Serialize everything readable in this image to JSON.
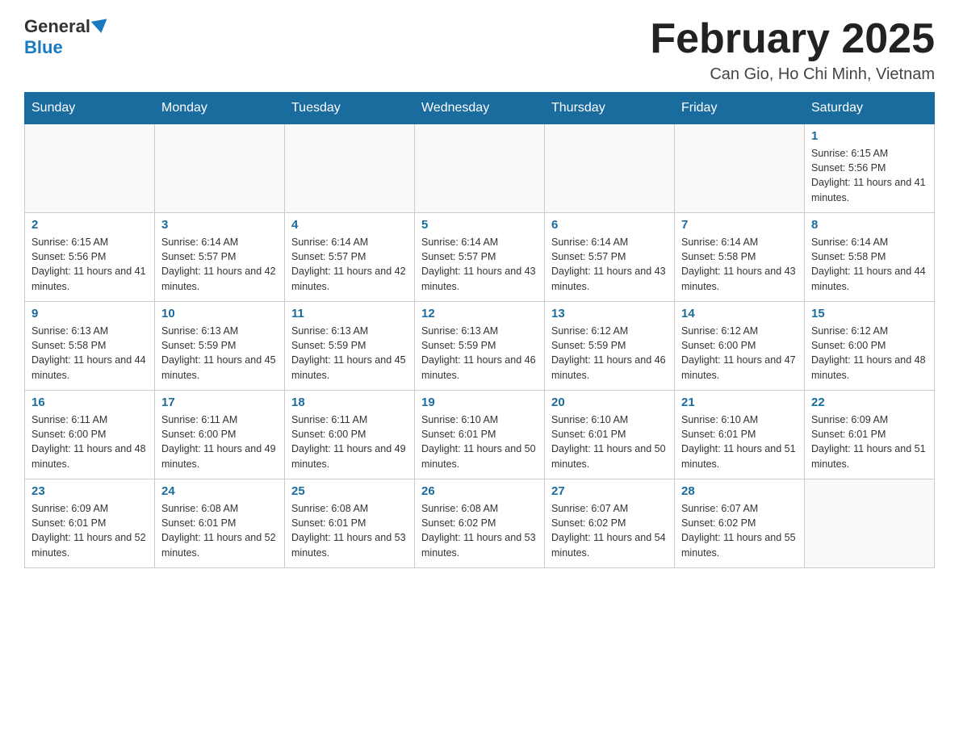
{
  "header": {
    "logo_general": "General",
    "logo_blue": "Blue",
    "title": "February 2025",
    "subtitle": "Can Gio, Ho Chi Minh, Vietnam"
  },
  "days_of_week": [
    "Sunday",
    "Monday",
    "Tuesday",
    "Wednesday",
    "Thursday",
    "Friday",
    "Saturday"
  ],
  "weeks": [
    [
      {
        "num": "",
        "info": ""
      },
      {
        "num": "",
        "info": ""
      },
      {
        "num": "",
        "info": ""
      },
      {
        "num": "",
        "info": ""
      },
      {
        "num": "",
        "info": ""
      },
      {
        "num": "",
        "info": ""
      },
      {
        "num": "1",
        "info": "Sunrise: 6:15 AM\nSunset: 5:56 PM\nDaylight: 11 hours and 41 minutes."
      }
    ],
    [
      {
        "num": "2",
        "info": "Sunrise: 6:15 AM\nSunset: 5:56 PM\nDaylight: 11 hours and 41 minutes."
      },
      {
        "num": "3",
        "info": "Sunrise: 6:14 AM\nSunset: 5:57 PM\nDaylight: 11 hours and 42 minutes."
      },
      {
        "num": "4",
        "info": "Sunrise: 6:14 AM\nSunset: 5:57 PM\nDaylight: 11 hours and 42 minutes."
      },
      {
        "num": "5",
        "info": "Sunrise: 6:14 AM\nSunset: 5:57 PM\nDaylight: 11 hours and 43 minutes."
      },
      {
        "num": "6",
        "info": "Sunrise: 6:14 AM\nSunset: 5:57 PM\nDaylight: 11 hours and 43 minutes."
      },
      {
        "num": "7",
        "info": "Sunrise: 6:14 AM\nSunset: 5:58 PM\nDaylight: 11 hours and 43 minutes."
      },
      {
        "num": "8",
        "info": "Sunrise: 6:14 AM\nSunset: 5:58 PM\nDaylight: 11 hours and 44 minutes."
      }
    ],
    [
      {
        "num": "9",
        "info": "Sunrise: 6:13 AM\nSunset: 5:58 PM\nDaylight: 11 hours and 44 minutes."
      },
      {
        "num": "10",
        "info": "Sunrise: 6:13 AM\nSunset: 5:59 PM\nDaylight: 11 hours and 45 minutes."
      },
      {
        "num": "11",
        "info": "Sunrise: 6:13 AM\nSunset: 5:59 PM\nDaylight: 11 hours and 45 minutes."
      },
      {
        "num": "12",
        "info": "Sunrise: 6:13 AM\nSunset: 5:59 PM\nDaylight: 11 hours and 46 minutes."
      },
      {
        "num": "13",
        "info": "Sunrise: 6:12 AM\nSunset: 5:59 PM\nDaylight: 11 hours and 46 minutes."
      },
      {
        "num": "14",
        "info": "Sunrise: 6:12 AM\nSunset: 6:00 PM\nDaylight: 11 hours and 47 minutes."
      },
      {
        "num": "15",
        "info": "Sunrise: 6:12 AM\nSunset: 6:00 PM\nDaylight: 11 hours and 48 minutes."
      }
    ],
    [
      {
        "num": "16",
        "info": "Sunrise: 6:11 AM\nSunset: 6:00 PM\nDaylight: 11 hours and 48 minutes."
      },
      {
        "num": "17",
        "info": "Sunrise: 6:11 AM\nSunset: 6:00 PM\nDaylight: 11 hours and 49 minutes."
      },
      {
        "num": "18",
        "info": "Sunrise: 6:11 AM\nSunset: 6:00 PM\nDaylight: 11 hours and 49 minutes."
      },
      {
        "num": "19",
        "info": "Sunrise: 6:10 AM\nSunset: 6:01 PM\nDaylight: 11 hours and 50 minutes."
      },
      {
        "num": "20",
        "info": "Sunrise: 6:10 AM\nSunset: 6:01 PM\nDaylight: 11 hours and 50 minutes."
      },
      {
        "num": "21",
        "info": "Sunrise: 6:10 AM\nSunset: 6:01 PM\nDaylight: 11 hours and 51 minutes."
      },
      {
        "num": "22",
        "info": "Sunrise: 6:09 AM\nSunset: 6:01 PM\nDaylight: 11 hours and 51 minutes."
      }
    ],
    [
      {
        "num": "23",
        "info": "Sunrise: 6:09 AM\nSunset: 6:01 PM\nDaylight: 11 hours and 52 minutes."
      },
      {
        "num": "24",
        "info": "Sunrise: 6:08 AM\nSunset: 6:01 PM\nDaylight: 11 hours and 52 minutes."
      },
      {
        "num": "25",
        "info": "Sunrise: 6:08 AM\nSunset: 6:01 PM\nDaylight: 11 hours and 53 minutes."
      },
      {
        "num": "26",
        "info": "Sunrise: 6:08 AM\nSunset: 6:02 PM\nDaylight: 11 hours and 53 minutes."
      },
      {
        "num": "27",
        "info": "Sunrise: 6:07 AM\nSunset: 6:02 PM\nDaylight: 11 hours and 54 minutes."
      },
      {
        "num": "28",
        "info": "Sunrise: 6:07 AM\nSunset: 6:02 PM\nDaylight: 11 hours and 55 minutes."
      },
      {
        "num": "",
        "info": ""
      }
    ]
  ]
}
